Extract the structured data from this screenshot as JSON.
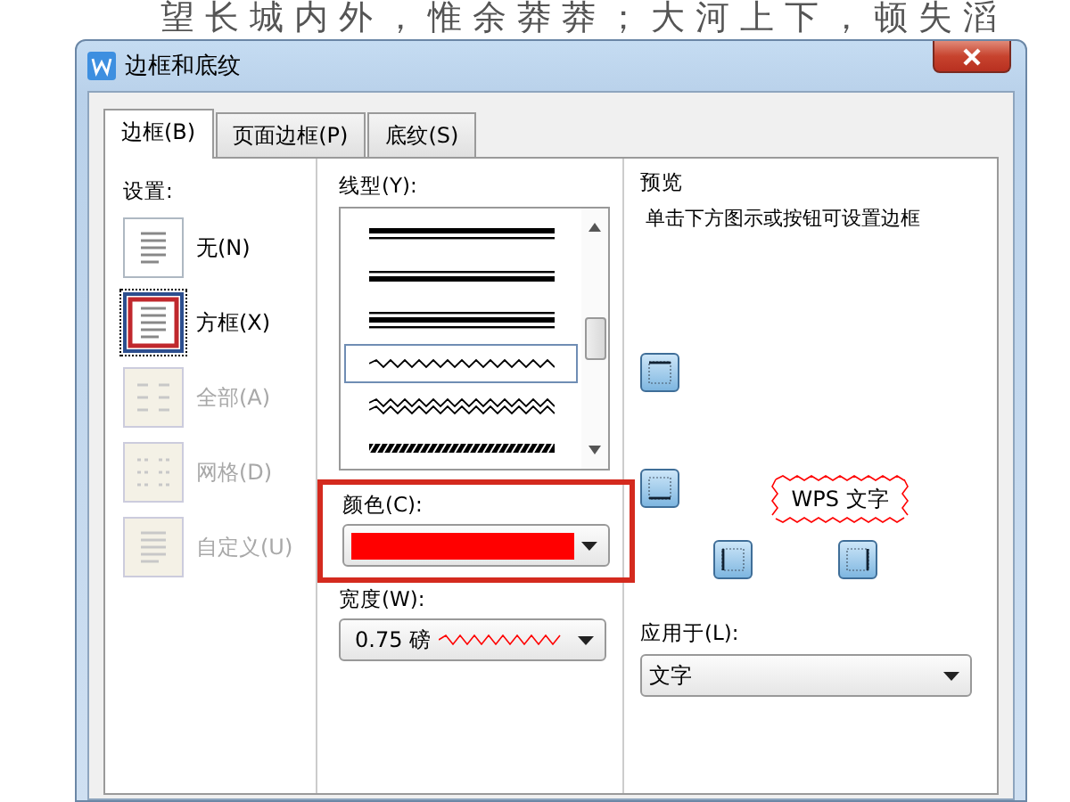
{
  "document": {
    "text": "望长城内外，惟余莽莽；大河上下，顿失滔"
  },
  "window": {
    "title": "边框和底纹"
  },
  "tabs": [
    {
      "label": "边框(B)",
      "selected": true
    },
    {
      "label": "页面边框(P)",
      "selected": false
    },
    {
      "label": "底纹(S)",
      "selected": false
    }
  ],
  "settings": {
    "label": "设置:",
    "items": [
      {
        "label": "无(N)",
        "kind": "none",
        "selected": false,
        "disabled": false
      },
      {
        "label": "方框(X)",
        "kind": "box",
        "selected": true,
        "disabled": false
      },
      {
        "label": "全部(A)",
        "kind": "all",
        "selected": false,
        "disabled": true
      },
      {
        "label": "网格(D)",
        "kind": "grid",
        "selected": false,
        "disabled": true
      },
      {
        "label": "自定义(U)",
        "kind": "custom",
        "selected": false,
        "disabled": true
      }
    ]
  },
  "line_style": {
    "label": "线型(Y):",
    "items": [
      {
        "kind": "thick-thin",
        "selected": false
      },
      {
        "kind": "thin-thick",
        "selected": false
      },
      {
        "kind": "thin-thick-thin",
        "selected": false
      },
      {
        "kind": "wave",
        "selected": true
      },
      {
        "kind": "double-wave",
        "selected": false
      },
      {
        "kind": "hatched",
        "selected": false
      }
    ]
  },
  "color": {
    "label": "颜色(C):",
    "color": "#ff0000",
    "highlighted": true
  },
  "width": {
    "label": "宽度(W):",
    "value": "0.75 磅"
  },
  "preview": {
    "label": "预览",
    "hint": "单击下方图示或按钮可设置边框",
    "sample": "WPS 文字",
    "buttons": [
      {
        "kind": "top"
      },
      {
        "kind": "bottom"
      },
      {
        "kind": "left"
      },
      {
        "kind": "right"
      }
    ]
  },
  "apply_to": {
    "label": "应用于(L):",
    "value": "文字"
  }
}
